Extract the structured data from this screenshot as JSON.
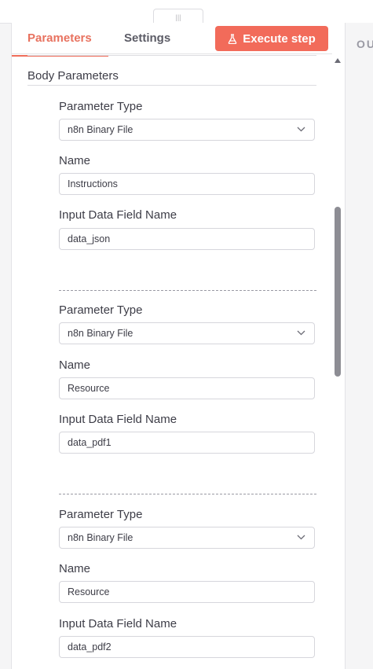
{
  "toolbar": {
    "drag_handle_glyph": "|||",
    "execute_label": "Execute step"
  },
  "tabs": [
    {
      "label": "Parameters",
      "active": true
    },
    {
      "label": "Settings",
      "active": false
    }
  ],
  "output_pane": {
    "label_partial": "OU"
  },
  "body_parameters": {
    "title": "Body Parameters",
    "items": [
      {
        "type_label": "Parameter Type",
        "type_value": "n8n Binary File",
        "name_label": "Name",
        "name_value": "Instructions",
        "field_label": "Input Data Field Name",
        "field_value": "data_json"
      },
      {
        "type_label": "Parameter Type",
        "type_value": "n8n Binary File",
        "name_label": "Name",
        "name_value": "Resource",
        "field_label": "Input Data Field Name",
        "field_value": "data_pdf1"
      },
      {
        "type_label": "Parameter Type",
        "type_value": "n8n Binary File",
        "name_label": "Name",
        "name_value": "Resource",
        "field_label": "Input Data Field Name",
        "field_value": "data_pdf2"
      }
    ]
  },
  "colors": {
    "accent": "#f26b5a",
    "tab_active": "#e8725f"
  },
  "icons": {
    "execute": "flask-icon",
    "dropdown": "chevron-down-icon",
    "scroll": "scroll-up-arrow-icon"
  }
}
